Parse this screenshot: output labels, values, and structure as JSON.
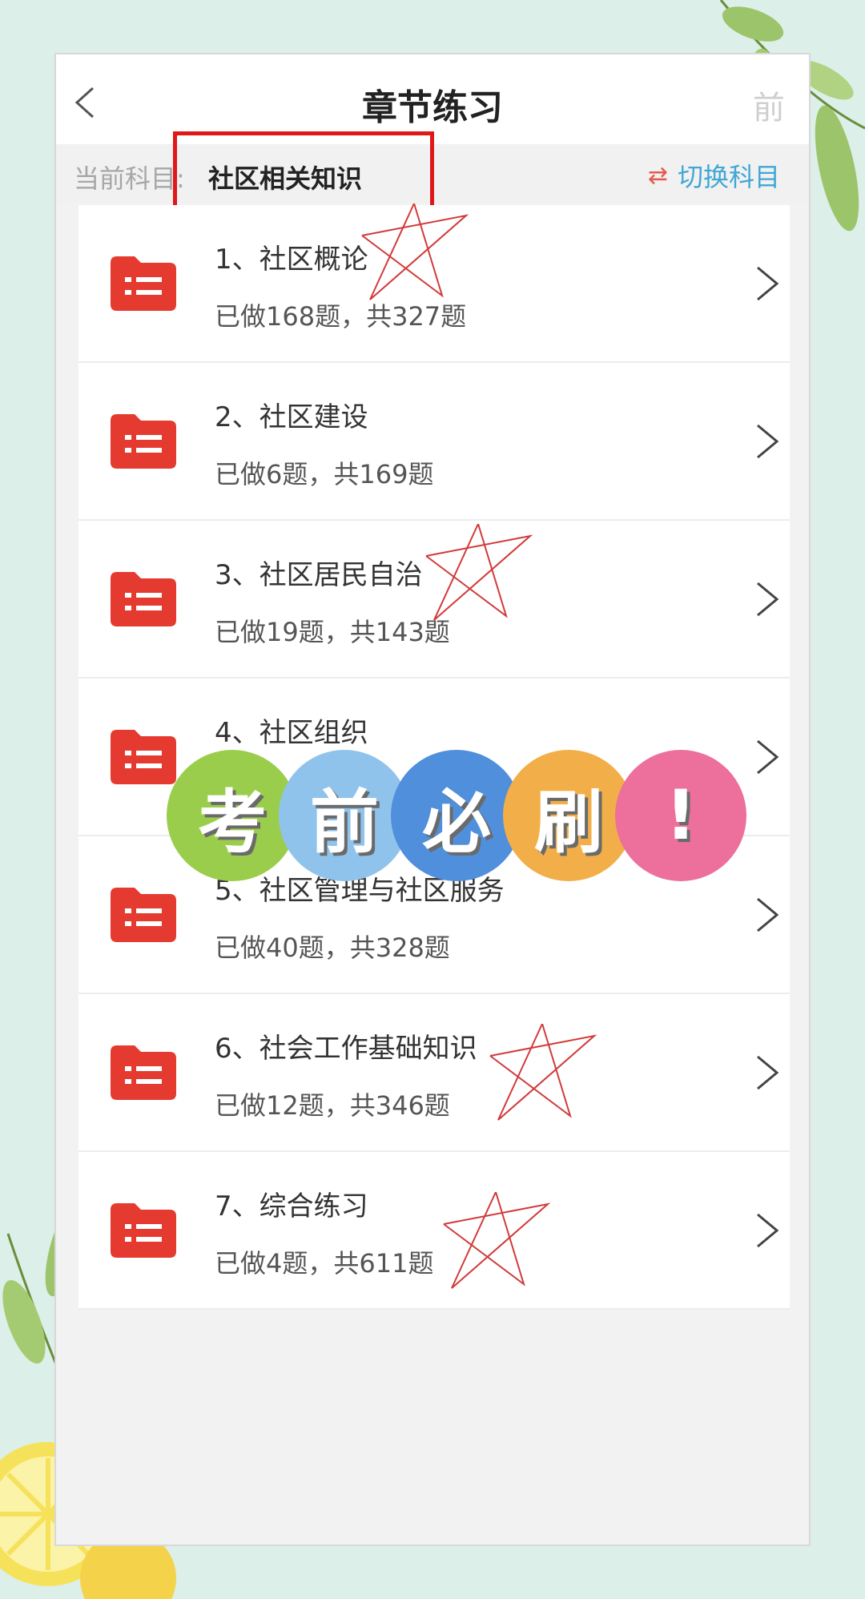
{
  "header": {
    "title": "章节练习",
    "right_action": "前"
  },
  "subject": {
    "label": "当前科目:",
    "current": "社区相关知识",
    "switch_label": "切换科目",
    "switch_icon": "swap-arrows-icon"
  },
  "chapters": [
    {
      "title": "1、社区概论",
      "progress": "已做168题，共327题",
      "icon": "folder-list-icon"
    },
    {
      "title": "2、社区建设",
      "progress": "已做6题，共169题",
      "icon": "folder-list-icon"
    },
    {
      "title": "3、社区居民自治",
      "progress": "已做19题，共143题",
      "icon": "folder-list-icon"
    },
    {
      "title": "4、社区组织",
      "progress": "",
      "icon": "folder-list-icon"
    },
    {
      "title": "5、社区管理与社区服务",
      "progress": "已做40题，共328题",
      "icon": "folder-list-icon"
    },
    {
      "title": "6、社会工作基础知识",
      "progress": "已做12题，共346题",
      "icon": "folder-list-icon"
    },
    {
      "title": "7、综合练习",
      "progress": "已做4题，共611题",
      "icon": "folder-list-icon"
    }
  ],
  "banner": {
    "chars": [
      "考",
      "前",
      "必",
      "刷",
      "!"
    ],
    "colors": [
      "#9bcd4c",
      "#8fc3ec",
      "#4f8fdc",
      "#f2ae48",
      "#ec6f9c"
    ]
  },
  "colors": {
    "folder": "#e53a2f",
    "switch_text": "#41a7d4",
    "highlight_box": "#e01818",
    "star_mark": "#d23a3a"
  }
}
